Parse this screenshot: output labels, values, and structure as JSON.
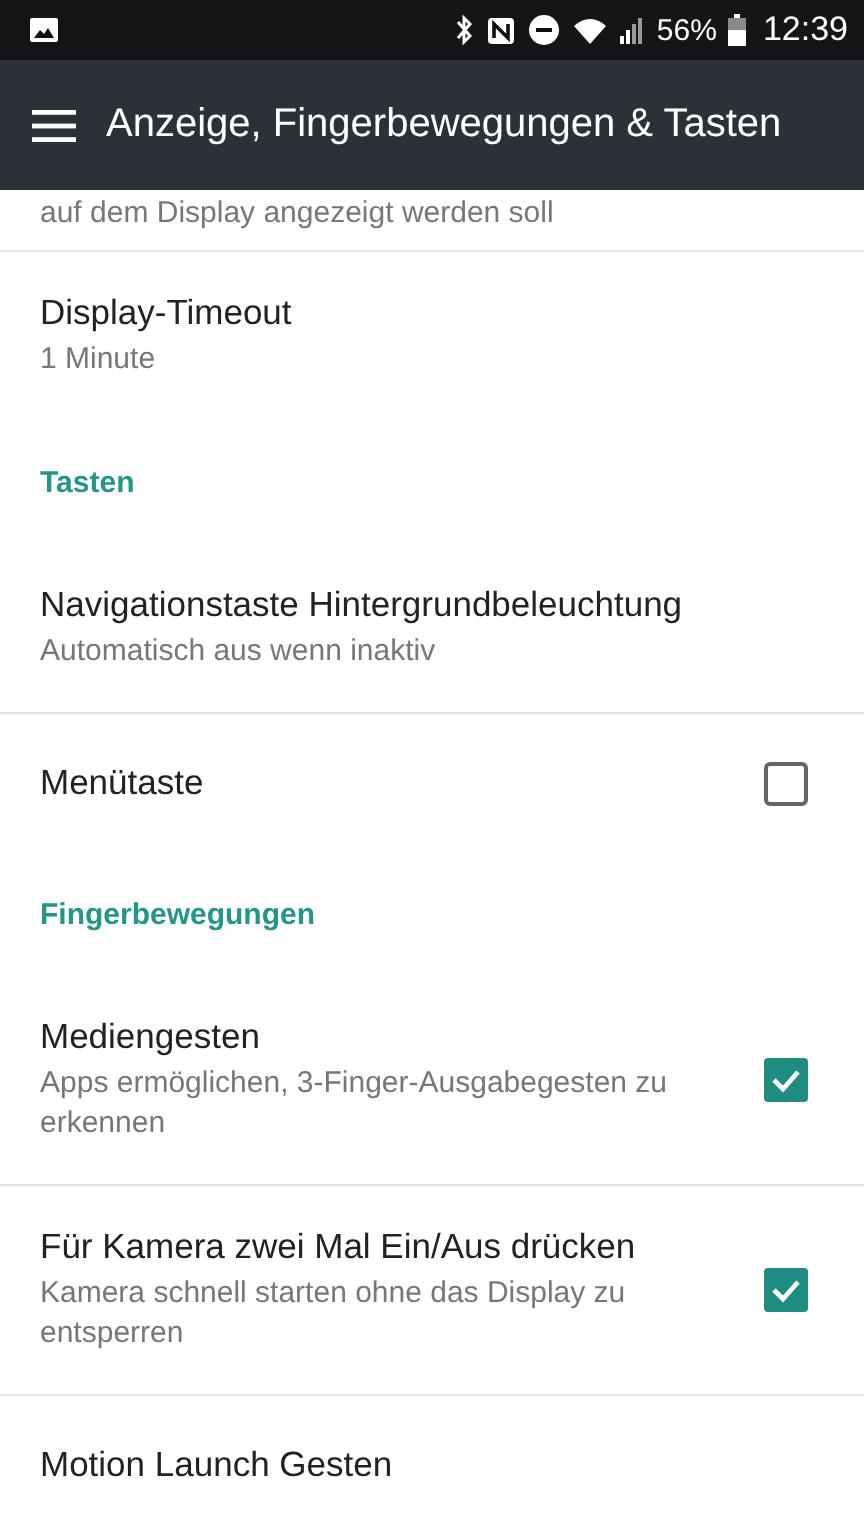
{
  "status_bar": {
    "battery": "56%",
    "time": "12:39"
  },
  "app_bar": {
    "title": "Anzeige, Fingerbewegungen & Tasten"
  },
  "items": [
    {
      "kind": "cut",
      "subtitle": "auf dem Display angezeigt werden soll"
    },
    {
      "kind": "text",
      "title": "Display-Timeout",
      "subtitle": "1 Minute"
    },
    {
      "kind": "header",
      "title": "Tasten"
    },
    {
      "kind": "text",
      "title": "Navigationstaste Hintergrundbeleuchtung",
      "subtitle": "Automatisch aus wenn inaktiv"
    },
    {
      "kind": "checkbox",
      "title": "Menütaste",
      "checked": false
    },
    {
      "kind": "header",
      "title": "Fingerbewegungen"
    },
    {
      "kind": "checkbox",
      "title": "Mediengesten",
      "subtitle": "Apps ermöglichen, 3-Finger-Ausgabegesten zu erkennen",
      "checked": true
    },
    {
      "kind": "checkbox",
      "title": "Für Kamera zwei Mal Ein/Aus drücken",
      "subtitle": "Kamera schnell starten ohne das Display zu entsperren",
      "checked": true
    },
    {
      "kind": "text",
      "title": "Motion Launch Gesten"
    }
  ]
}
